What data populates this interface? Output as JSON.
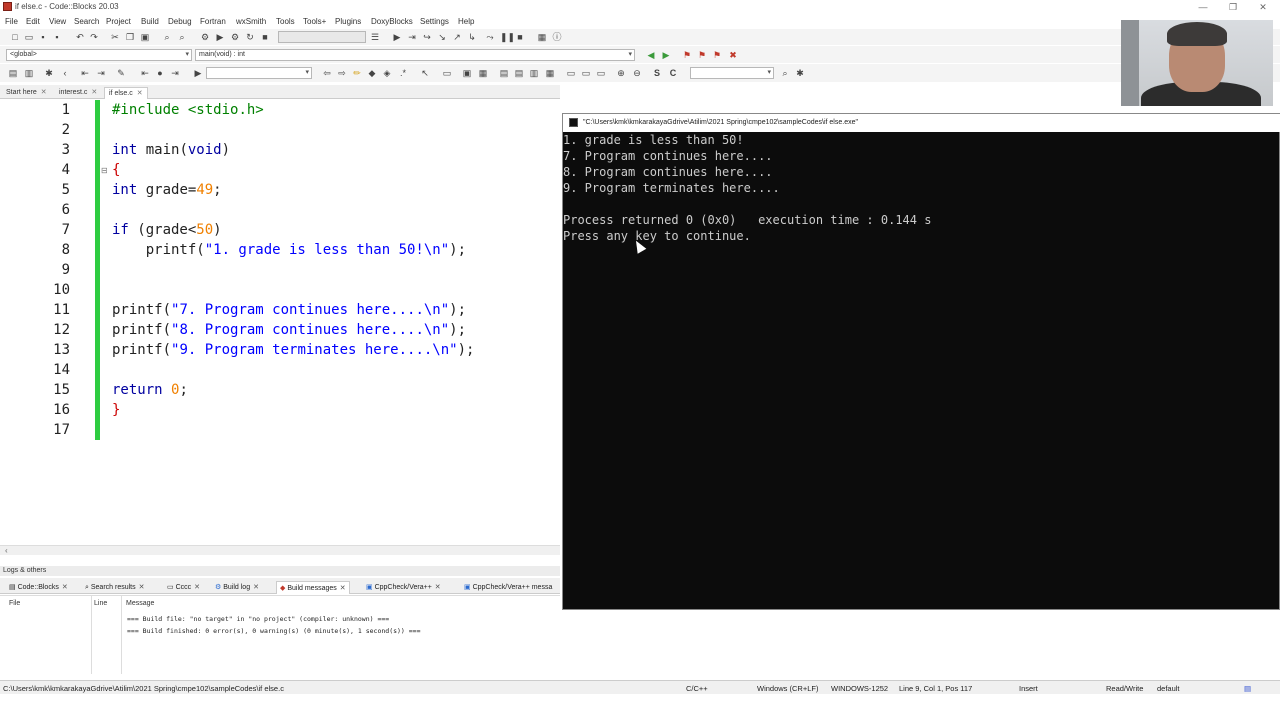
{
  "window": {
    "title": "if else.c - Code::Blocks 20.03",
    "controls": {
      "minimize": "—",
      "restore": "❐",
      "close": "✕"
    }
  },
  "menu": [
    "File",
    "Edit",
    "View",
    "Search",
    "Project",
    "Build",
    "Debug",
    "Fortran",
    "wxSmith",
    "Tools",
    "Tools+",
    "Plugins",
    "DoxyBlocks",
    "Settings",
    "Help"
  ],
  "toolbar": {
    "scope_combo": "<global>",
    "function_combo": "main(void) : int"
  },
  "editor_tabs": [
    {
      "label": "Start here",
      "close": "✕"
    },
    {
      "label": "interest.c",
      "close": "✕"
    },
    {
      "label": "if else.c",
      "close": "✕"
    }
  ],
  "code_lines": [
    {
      "n": "1"
    },
    {
      "n": "2"
    },
    {
      "n": "3"
    },
    {
      "n": "4"
    },
    {
      "n": "5"
    },
    {
      "n": "6"
    },
    {
      "n": "7"
    },
    {
      "n": "8"
    },
    {
      "n": "9"
    },
    {
      "n": "10"
    },
    {
      "n": "11"
    },
    {
      "n": "12"
    },
    {
      "n": "13"
    },
    {
      "n": "14"
    },
    {
      "n": "15"
    },
    {
      "n": "16"
    },
    {
      "n": "17"
    }
  ],
  "code": {
    "l1_pre": "#include",
    "l1_hdr": "<stdio.h>",
    "l3_kw": "int",
    "l3_name": " main(",
    "l3_void": "void",
    "l3_end": ")",
    "l4": "{",
    "l5_kw": "int",
    "l5_rest": " grade=",
    "l5_num": "49",
    "l5_end": ";",
    "l7_kw": "if",
    "l7_rest": " (grade<",
    "l7_num": "50",
    "l7_end": ")",
    "l8_fn": "    printf(",
    "l8_str": "\"1. grade is less than 50!\\n\"",
    "l8_end": ");",
    "l11_fn": "printf(",
    "l11_str": "\"7. Program continues here....\\n\"",
    "l11_end": ");",
    "l12_fn": "printf(",
    "l12_str": "\"8. Program continues here....\\n\"",
    "l12_end": ");",
    "l13_fn": "printf(",
    "l13_str": "\"9. Program terminates here....\\n\"",
    "l13_end": ");",
    "l15_kw": "return",
    "l15_sp": " ",
    "l15_num": "0",
    "l15_end": ";",
    "l16": "}"
  },
  "logs": {
    "header": "Logs & others",
    "tabs": [
      {
        "label": "Code::Blocks",
        "close": "✕"
      },
      {
        "label": "Search results",
        "close": "✕"
      },
      {
        "label": "Cccc",
        "close": "✕"
      },
      {
        "label": "Build log",
        "close": "✕"
      },
      {
        "label": "Build messages",
        "close": "✕"
      },
      {
        "label": "CppCheck/Vera++",
        "close": "✕"
      },
      {
        "label": "CppCheck/Vera++ messa",
        "close": ""
      }
    ],
    "columns": {
      "file": "File",
      "line": "Line",
      "message": "Message"
    },
    "messages": [
      "=== Build file: \"no target\" in \"no project\" (compiler: unknown) ===",
      "=== Build finished: 0 error(s), 0 warning(s) (0 minute(s), 1 second(s)) ==="
    ]
  },
  "status": {
    "path": "C:\\Users\\kmk\\kmkarakayaGdrive\\Atilim\\2021 Spring\\cmpe102\\sampleCodes\\if else.c",
    "lang": "C/C++",
    "eol": "Windows (CR+LF)",
    "encoding": "WINDOWS-1252",
    "position": "Line 9, Col 1, Pos 117",
    "mode": "Insert",
    "access": "Read/Write",
    "profile": "default"
  },
  "console": {
    "title": "\"C:\\Users\\kmk\\kmkarakayaGdrive\\Atilim\\2021 Spring\\cmpe102\\sampleCodes\\if else.exe\"",
    "lines": [
      "1. grade is less than 50!",
      "7. Program continues here....",
      "8. Program continues here....",
      "9. Program terminates here....",
      "",
      "Process returned 0 (0x0)   execution time : 0.144 s",
      "Press any key to continue."
    ]
  }
}
